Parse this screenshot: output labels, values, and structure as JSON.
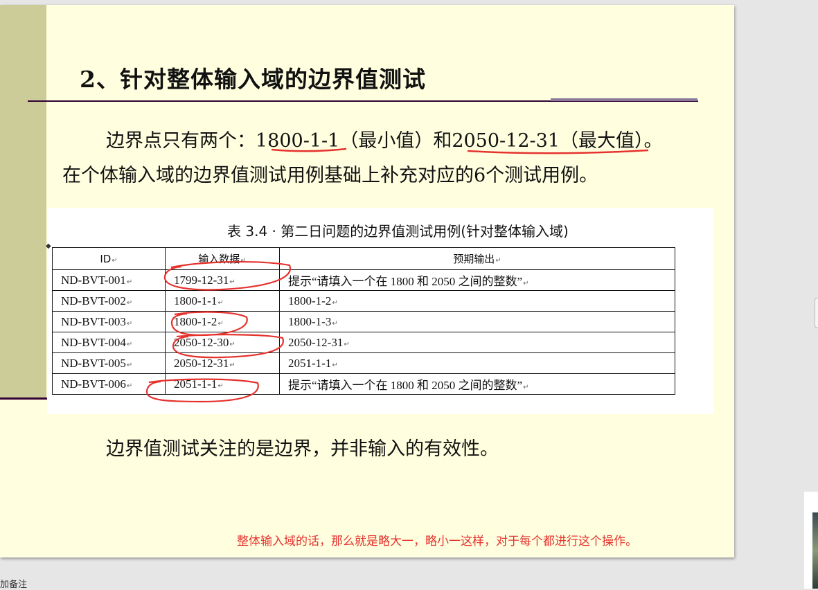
{
  "slide": {
    "title": "2、针对整体输入域的边界值测试",
    "para1_prefix": "边界点只有两个：",
    "para1_min": "1800-1-1",
    "para1_min_label": "（最小值）和",
    "para1_max": "2050-12-31",
    "para1_max_label": "（最大值）。",
    "para2": "在个体输入域的边界值测试用例基础上补充对应的6个测试用例。",
    "para3": "边界值测试关注的是边界，并非输入的有效性。"
  },
  "table": {
    "caption": "表 3.4 · 第二日问题的边界值测试用例(针对整体输入域)",
    "headers": [
      "ID",
      "输入数据",
      "预期输出"
    ],
    "rows": [
      [
        "ND-BVT-001",
        "1799-12-31",
        "提示“请填入一个在 1800 和 2050 之间的整数”"
      ],
      [
        "ND-BVT-002",
        "1800-1-1",
        "1800-1-2"
      ],
      [
        "ND-BVT-003",
        "1800-1-2",
        "1800-1-3"
      ],
      [
        "ND-BVT-004",
        "2050-12-30",
        "2050-12-31"
      ],
      [
        "ND-BVT-005",
        "2050-12-31",
        "2051-1-1"
      ],
      [
        "ND-BVT-006",
        "2051-1-1",
        "提示“请填入一个在 1800 和 2050 之间的整数”"
      ]
    ]
  },
  "note": "整体输入域的话，那么就是略大一，略小一这样，对于每个都进行这个操作。",
  "status_bar": {
    "notes_label": "加备注"
  },
  "colors": {
    "slide_bg": "#ffffe0",
    "left_bar": "#cccc99",
    "rule": "#330033",
    "annotation_red": "#e5322d"
  }
}
